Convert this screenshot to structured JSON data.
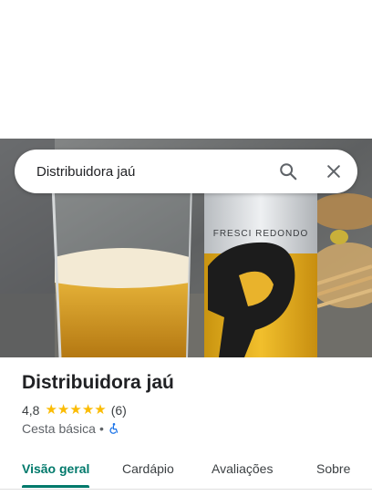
{
  "search": {
    "value": "Distribuidora jaú"
  },
  "place": {
    "name": "Distribuidora jaú",
    "rating": "4,8",
    "stars": 5,
    "review_count": "(6)",
    "category": "Cesta básica",
    "separator": "•"
  },
  "photo": {
    "can_text": "FRESCI REDONDO"
  },
  "tabs": [
    {
      "label": "Visão geral",
      "active": true
    },
    {
      "label": "Cardápio",
      "active": false
    },
    {
      "label": "Avaliações",
      "active": false
    },
    {
      "label": "Sobre",
      "active": false
    }
  ],
  "colors": {
    "accent": "#00796b",
    "star": "#fbbc04",
    "accessible_icon": "#1a73e8"
  },
  "icons": [
    "search-icon",
    "close-icon",
    "accessible-icon",
    "star-icon"
  ]
}
